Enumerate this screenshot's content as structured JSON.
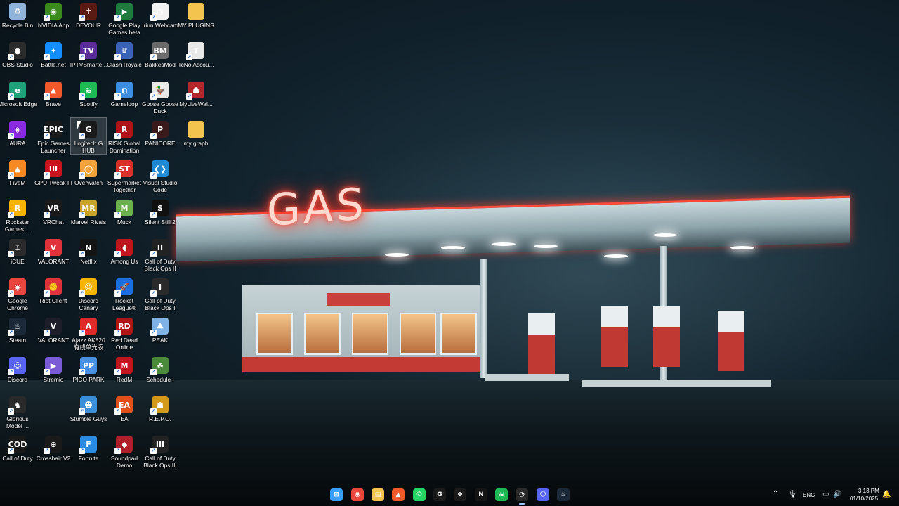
{
  "wallpaper": {
    "sign_text": "GAS"
  },
  "icons": [
    {
      "label": "Recycle Bin",
      "icon": "recycle-bin-icon",
      "color": "#8fb3d9",
      "glyph": "♻"
    },
    {
      "label": "NVIDIA App",
      "icon": "nvidia-icon",
      "color": "#3b8a1d",
      "glyph": "◉"
    },
    {
      "label": "DEVOUR",
      "icon": "devour-icon",
      "color": "#5a1b14",
      "glyph": "✝"
    },
    {
      "label": "Google Play Games beta",
      "icon": "google-play-games-icon",
      "color": "#1e7b3d",
      "glyph": "▶"
    },
    {
      "label": "Iriun Webcam",
      "icon": "webcam-icon",
      "color": "#f2f2f2",
      "glyph": "◎"
    },
    {
      "label": "MY PLUGINS",
      "icon": "folder-icon",
      "color": "#f3c44e",
      "glyph": ""
    },
    {
      "label": "OBS Studio",
      "icon": "obs-icon",
      "color": "#2b2b2b",
      "glyph": "●"
    },
    {
      "label": "Battle.net",
      "icon": "battlenet-icon",
      "color": "#148eff",
      "glyph": "✦"
    },
    {
      "label": "IPTVSmarte...",
      "icon": "iptv-icon",
      "color": "#5a2d9a",
      "glyph": "TV"
    },
    {
      "label": "Clash Royale",
      "icon": "clash-royale-icon",
      "color": "#3a63b8",
      "glyph": "♛"
    },
    {
      "label": "BakkesMod",
      "icon": "bakkesmod-icon",
      "color": "#6b6b6b",
      "glyph": "BM"
    },
    {
      "label": "TcNo Accou...",
      "icon": "tcno-icon",
      "color": "#e8e8e8",
      "glyph": "T"
    },
    {
      "label": "Microsoft Edge",
      "icon": "edge-icon",
      "color": "#1fa17a",
      "glyph": "e"
    },
    {
      "label": "Brave",
      "icon": "brave-icon",
      "color": "#f1582a",
      "glyph": "▲"
    },
    {
      "label": "Spotify",
      "icon": "spotify-icon",
      "color": "#1db954",
      "glyph": "≋"
    },
    {
      "label": "Gameloop",
      "icon": "gameloop-icon",
      "color": "#3d8de0",
      "glyph": "◐"
    },
    {
      "label": "Goose Goose Duck",
      "icon": "goose-icon",
      "color": "#e9e9e9",
      "glyph": "🦆"
    },
    {
      "label": "MyLiveWal...",
      "icon": "mylivewallpaper-icon",
      "color": "#b3262a",
      "glyph": "☗"
    },
    {
      "label": "AURA",
      "icon": "aura-icon",
      "color": "#8a2be2",
      "glyph": "◈"
    },
    {
      "label": "Epic Games Launcher",
      "icon": "epic-games-icon",
      "color": "#1a1a1a",
      "glyph": "EPIC"
    },
    {
      "label": "Logitech G HUB",
      "icon": "logitech-icon",
      "color": "#1a1a1a",
      "glyph": "G"
    },
    {
      "label": "RISK Global Domination",
      "icon": "risk-icon",
      "color": "#b0141a",
      "glyph": "R"
    },
    {
      "label": "PANICORE",
      "icon": "panicore-icon",
      "color": "#3a1a1a",
      "glyph": "P"
    },
    {
      "label": "my graph",
      "icon": "folder-icon",
      "color": "#f3c44e",
      "glyph": ""
    },
    {
      "label": "FiveM",
      "icon": "fivem-icon",
      "color": "#f58a24",
      "glyph": "▲"
    },
    {
      "label": "GPU Tweak III",
      "icon": "gpu-tweak-icon",
      "color": "#c9141e",
      "glyph": "III"
    },
    {
      "label": "Overwatch",
      "icon": "overwatch-icon",
      "color": "#f2a23a",
      "glyph": "◯"
    },
    {
      "label": "Supermarket Together",
      "icon": "supermarket-icon",
      "color": "#d9302b",
      "glyph": "ST"
    },
    {
      "label": "Visual Studio Code",
      "icon": "vscode-icon",
      "color": "#1e8ad6",
      "glyph": "❮❯"
    },
    {
      "label": "Rockstar Games ...",
      "icon": "rockstar-icon",
      "color": "#f6b500",
      "glyph": "R"
    },
    {
      "label": "VRChat",
      "icon": "vrchat-icon",
      "color": "#1a1a1a",
      "glyph": "VR"
    },
    {
      "label": "Marvel Rivals",
      "icon": "marvel-rivals-icon",
      "color": "#c9a32a",
      "glyph": "MR"
    },
    {
      "label": "Muck",
      "icon": "muck-icon",
      "color": "#6ab04c",
      "glyph": "M"
    },
    {
      "label": "Silent Still 2",
      "icon": "silent-still-icon",
      "color": "#101010",
      "glyph": "S"
    },
    {
      "label": "iCUE",
      "icon": "icue-icon",
      "color": "#2a2a2a",
      "glyph": "⚓"
    },
    {
      "label": "VALORANT",
      "icon": "valorant-icon",
      "color": "#e0323c",
      "glyph": "V"
    },
    {
      "label": "Netflix",
      "icon": "netflix-icon",
      "color": "#141414",
      "glyph": "N"
    },
    {
      "label": "Among Us",
      "icon": "among-us-icon",
      "color": "#c0141e",
      "glyph": "◖"
    },
    {
      "label": "Call of Duty Black Ops II",
      "icon": "cod-bo2-icon",
      "color": "#222222",
      "glyph": "II"
    },
    {
      "label": "Google Chrome",
      "icon": "chrome-icon",
      "color": "#e8453c",
      "glyph": "◉"
    },
    {
      "label": "Riot Client",
      "icon": "riot-client-icon",
      "color": "#e0323c",
      "glyph": "✊"
    },
    {
      "label": "Discord Canary",
      "icon": "discord-canary-icon",
      "color": "#f4b400",
      "glyph": "☺"
    },
    {
      "label": "Rocket League®",
      "icon": "rocket-league-icon",
      "color": "#1b6ee0",
      "glyph": "🚀"
    },
    {
      "label": "Call of Duty Black Ops I",
      "icon": "cod-bo1-icon",
      "color": "#2a2a2a",
      "glyph": "I"
    },
    {
      "label": "Steam",
      "icon": "steam-icon",
      "color": "#1b2838",
      "glyph": "♨"
    },
    {
      "label": "VALORANT",
      "icon": "valorant-icon",
      "color": "#1e1e2a",
      "glyph": "V"
    },
    {
      "label": "Ajazz AK820 有线单光版",
      "icon": "ajazz-icon",
      "color": "#e02a2a",
      "glyph": "A"
    },
    {
      "label": "Red Dead Online",
      "icon": "red-dead-icon",
      "color": "#b01414",
      "glyph": "RD"
    },
    {
      "label": "PEAK",
      "icon": "peak-icon",
      "color": "#7fb2e6",
      "glyph": "⛰"
    },
    {
      "label": "Discord",
      "icon": "discord-icon",
      "color": "#5865f2",
      "glyph": "☺"
    },
    {
      "label": "Stremio",
      "icon": "stremio-icon",
      "color": "#7b5bd6",
      "glyph": "▶"
    },
    {
      "label": "PICO PARK",
      "icon": "pico-park-icon",
      "color": "#4a8fe0",
      "glyph": "PP"
    },
    {
      "label": "RedM",
      "icon": "redm-icon",
      "color": "#c0141e",
      "glyph": "M"
    },
    {
      "label": "Schedule I",
      "icon": "schedule-icon",
      "color": "#4a8a3a",
      "glyph": "☘"
    },
    {
      "label": "Glorious Model ...",
      "icon": "glorious-icon",
      "color": "#2a2a2a",
      "glyph": "♞"
    },
    {
      "label": "Stumble Guys",
      "icon": "stumble-guys-icon",
      "color": "#3a8fd8",
      "glyph": "☻"
    },
    {
      "label": "EA",
      "icon": "ea-icon",
      "color": "#e2501a",
      "glyph": "EA"
    },
    {
      "label": "R.E.P.O.",
      "icon": "repo-icon",
      "color": "#d39a1a",
      "glyph": "☗"
    },
    {
      "label": "Call of Duty",
      "icon": "cod-icon",
      "color": "#1a1a1a",
      "glyph": "COD"
    },
    {
      "label": "Crosshair V2",
      "icon": "crosshair-icon",
      "color": "#1a1a1a",
      "glyph": "⊕"
    },
    {
      "label": "Fortnite",
      "icon": "fortnite-icon",
      "color": "#2a8be0",
      "glyph": "F"
    },
    {
      "label": "Soundpad Demo",
      "icon": "soundpad-icon",
      "color": "#b0202a",
      "glyph": "◆"
    },
    {
      "label": "Call of Duty Black Ops III",
      "icon": "cod-bo3-icon",
      "color": "#222222",
      "glyph": "III"
    }
  ],
  "taskbar": {
    "apps": [
      {
        "name": "start-button",
        "icon": "windows-start-icon",
        "color": "#3aa0ff",
        "glyph": "⊞"
      },
      {
        "name": "taskbar-chrome",
        "icon": "chrome-icon",
        "color": "#e8453c",
        "glyph": "◉"
      },
      {
        "name": "taskbar-file-explorer",
        "icon": "folder-icon",
        "color": "#f3c44e",
        "glyph": "▤"
      },
      {
        "name": "taskbar-brave",
        "icon": "brave-icon",
        "color": "#f1582a",
        "glyph": "▲"
      },
      {
        "name": "taskbar-whatsapp",
        "icon": "whatsapp-icon",
        "color": "#25d366",
        "glyph": "✆"
      },
      {
        "name": "taskbar-logitech",
        "icon": "logitech-icon",
        "color": "#1a1a1a",
        "glyph": "G"
      },
      {
        "name": "taskbar-crosshair",
        "icon": "crosshair-icon",
        "color": "#1a1a1a",
        "glyph": "⊕"
      },
      {
        "name": "taskbar-netflix",
        "icon": "netflix-icon",
        "color": "#141414",
        "glyph": "N"
      },
      {
        "name": "taskbar-spotify",
        "icon": "spotify-icon",
        "color": "#1db954",
        "glyph": "≋"
      },
      {
        "name": "taskbar-speedometer",
        "icon": "speedometer-icon",
        "color": "#2a2a2a",
        "glyph": "◔"
      },
      {
        "name": "taskbar-discord",
        "icon": "discord-icon",
        "color": "#5865f2",
        "glyph": "☺"
      },
      {
        "name": "taskbar-steam",
        "icon": "steam-icon",
        "color": "#1b2838",
        "glyph": "♨"
      }
    ],
    "tray": {
      "language": "ENG",
      "time": "3:13 PM",
      "date": "01/10/2025"
    }
  }
}
